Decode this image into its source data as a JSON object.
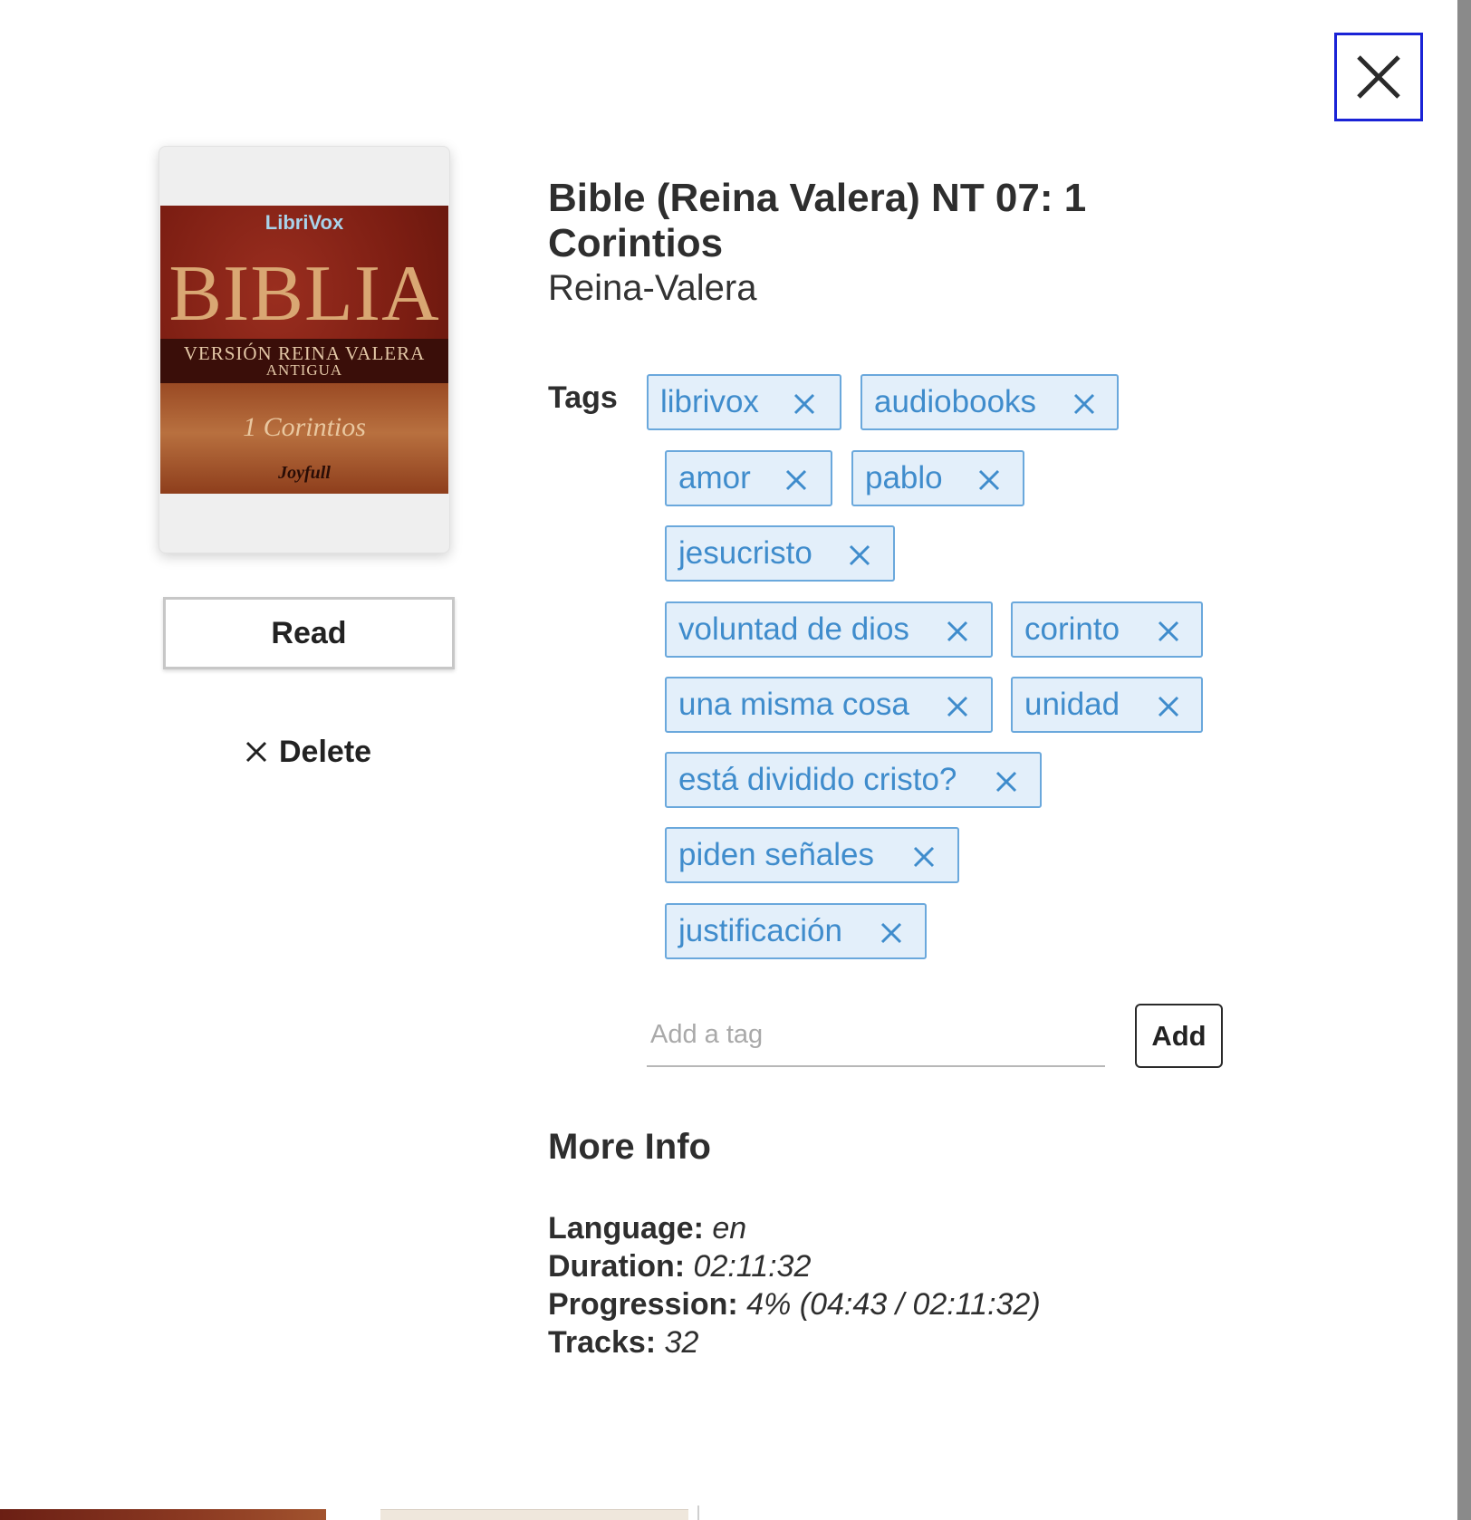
{
  "book": {
    "title": "Bible (Reina Valera) NT 07: 1 Corintios",
    "author": "Reina-Valera"
  },
  "cover": {
    "brand": "LibriVox",
    "title": "BIBLIA",
    "subtitle_line1": "VERSIÓN REINA VALERA",
    "subtitle_line2": "ANTIGUA",
    "book_name": "1 Corintios",
    "signature": "Joyfull"
  },
  "actions": {
    "read_label": "Read",
    "delete_label": "Delete"
  },
  "tags": {
    "label": "Tags",
    "items": [
      {
        "label": "librivox"
      },
      {
        "label": "audiobooks"
      },
      {
        "label": "amor"
      },
      {
        "label": "pablo"
      },
      {
        "label": "jesucristo"
      },
      {
        "label": "voluntad de dios"
      },
      {
        "label": "corinto"
      },
      {
        "label": "una misma cosa"
      },
      {
        "label": "unidad"
      },
      {
        "label": "está dividido cristo?"
      },
      {
        "label": "piden señales"
      },
      {
        "label": "justificación"
      }
    ],
    "input_placeholder": "Add a tag",
    "add_label": "Add"
  },
  "more_info": {
    "heading": "More Info",
    "language_key": "Language:",
    "language_value": "en",
    "duration_key": "Duration:",
    "duration_value": "02:11:32",
    "progression_key": "Progression:",
    "progression_value": "4% (04:43 / 02:11:32)",
    "tracks_key": "Tracks:",
    "tracks_value": "32"
  },
  "icons": {
    "close": "close-icon",
    "delete": "x-icon",
    "tag_remove": "tag-remove-icon"
  },
  "colors": {
    "tag_bg": "#e3effa",
    "tag_border": "#6aa8dc",
    "tag_text": "#3f8ccc",
    "focus_ring": "#1a23d6"
  }
}
